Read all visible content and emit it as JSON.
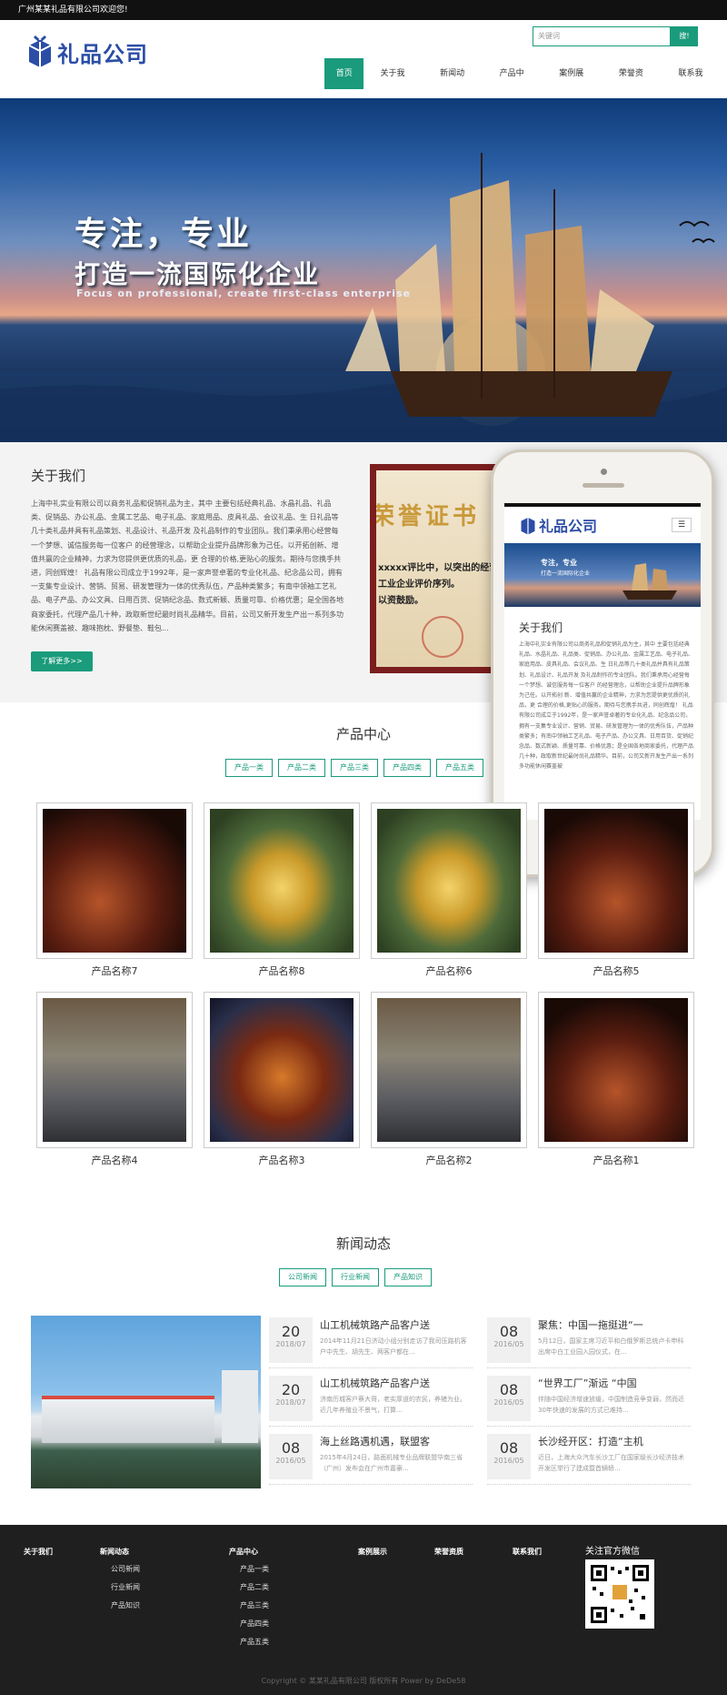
{
  "topbar": {
    "welcome": "广州某某礼品有限公司欢迎您!"
  },
  "header": {
    "logo_text": "礼品公司",
    "search_placeholder": "关键词",
    "search_button": "搜!",
    "nav": [
      "首页",
      "关于我们",
      "新闻动态",
      "产品中心",
      "案例展示",
      "荣誉资质",
      "联系我们"
    ]
  },
  "banner": {
    "headline1": "专注，专业",
    "headline2": "打造一流国际化企业",
    "subtitle": "Focus on professional, create first-class enterprise"
  },
  "about": {
    "title": "关于我们",
    "text": "上海中礼实业有限公司以商务礼品和促销礼品为主，其中 主要包括经典礼品、水晶礼品、礼品类、促销品、办公礼品、金属工艺品、电子礼品、家庭用品、皮具礼品、会议礼品、生 日礼品等几十类礼品并具有礼品策划、礼品设计、礼品开发 及礼品制作的专业团队。我们秉承用心经营每一个梦想、诚信服务每一位客户 的经营理念，以帮助企业提升品牌形象为己任。以开拓创新、增值共赢的企业精神，力求为您提供更优质的礼品，更 合理的价格,更贴心的服务。期待与您携手共进，同创辉煌！ 礼品有限公司成立于1992年，是一家声誉卓著的专业化礼品、纪念品公司，拥有一支集专业设计、营销、贸易、研发管理为一体的优秀队伍，产品种类繁多；有南中领袖工艺礼品、电子产品、办公文具、日用百货、促销纪念品、数式新颖、质量可靠、价格优惠；是全国各地商家委托，代理产品几十种，政取新世纪最时尚礼品精华。目前，公司又新开发生产出一系列多功能休闲赛盖被、趣味抱枕、野餐垫、鞋包...",
    "more_button": "了解更多>>",
    "certificate": {
      "title": "荣誉证书",
      "line1": "xxxxx评比中，以突出的经营",
      "line2": "工业企业评价序列。",
      "line3": "以资鼓励。"
    }
  },
  "phone": {
    "logo_text": "礼品公司",
    "banner_line1": "专注，专业",
    "banner_line2": "打造一流国际化企业",
    "about_title": "关于我们",
    "about_text": "上海中礼实业有限公司以商务礼品和促销礼品为主，其中 主要包括经典礼品、水晶礼品、礼品类、促销品、办公礼品、金属工艺品、电子礼品、家庭用品、皮具礼品、会议礼品、生 日礼品等几十类礼品并具有礼品策划、礼品设计、礼品开发 及礼品制作的专业团队。我们秉承用心经营每一个梦想、诚信服务每一位客户 的经营理念，以帮助企业提升品牌形象为己任。以开拓创 新、增值共赢的企业精神，力求为您提供更优质的礼品，更 合理的价格,更贴心的服务。期待与您携手共进，同创辉煌！ 礼品有限公司成立于1992年，是一家声誉卓著的专业化礼品、纪念品公司，拥有一支集专业设计、营销、贸易、研发管理为一体的优秀队伍，产品种类繁多；有南中领袖工艺礼品、电子产品、办公文具、日用百货、促销纪念品、数式新颖、质量可靠、价格优惠；是全国各地商家委托，代理产品几十种，政取新世纪最时尚礼品精华。目前，公司又新开发生产出一系列多功能休闲赛盖被"
  },
  "products": {
    "title": "产品中心",
    "categories": [
      "产品一类",
      "产品二类",
      "产品三类",
      "产品四类",
      "产品五类"
    ],
    "items": [
      {
        "name": "产品名称7",
        "theme": "dragon"
      },
      {
        "name": "产品名称8",
        "theme": "gold"
      },
      {
        "name": "产品名称6",
        "theme": "gold"
      },
      {
        "name": "产品名称5",
        "theme": "dragon"
      },
      {
        "name": "产品名称4",
        "theme": "tea"
      },
      {
        "name": "产品名称3",
        "theme": "storm"
      },
      {
        "name": "产品名称2",
        "theme": "tea"
      },
      {
        "name": "产品名称1",
        "theme": "dragon"
      }
    ]
  },
  "news": {
    "title": "新闻动态",
    "categories": [
      "公司新闻",
      "行业新闻",
      "产品知识"
    ],
    "left": [
      {
        "day": "20",
        "ym": "2018/07",
        "title": "山工机械筑路产品客户送",
        "summary": "2014年11月21日济动小组分别走访了我司压路机客户中先生、胡先生、两客户都在..."
      },
      {
        "day": "20",
        "ym": "2018/07",
        "title": "山工机械筑路产品客户送",
        "summary": "济南历城客户蔡大哥，老实厚道的农民，养猪为业。近几年养殖业不景气，打算..."
      },
      {
        "day": "08",
        "ym": "2016/05",
        "title": "海上丝路遇机遇，联盟客",
        "summary": "2015年4月24日，路面机械专业品牌联盟华南三省（广州）发布会在广州市嘉豪..."
      }
    ],
    "right": [
      {
        "day": "08",
        "ym": "2016/05",
        "title": "聚焦：中国一拖挺进“一",
        "summary": "5月12日，国家主席习近平和白俄罗斯总统卢卡申科出席中白工业园入园仪式，在..."
      },
      {
        "day": "08",
        "ym": "2016/05",
        "title": "“世界工厂”渐远 “中国",
        "summary": "伴随中国经济增速放缓，中国制造竞争变弱，然而近30年快速的发展的方式已难持..."
      },
      {
        "day": "08",
        "ym": "2016/05",
        "title": "长沙经开区：打造“主机",
        "summary": "近日，上海大众汽车长沙工厂在国家级长沙经济技术开发区举行了建成暨首辆轿..."
      }
    ]
  },
  "footer": {
    "about": "关于我们",
    "news": "新闻动态",
    "news_items": [
      "公司新闻",
      "行业新闻",
      "产品知识"
    ],
    "products": "产品中心",
    "product_items": [
      "产品一类",
      "产品二类",
      "产品三类",
      "产品四类",
      "产品五类"
    ],
    "cases": "案例展示",
    "honors": "荣誉资质",
    "contact": "联系我们",
    "wechat": "关注官方微信",
    "copyright": "Copyright © 某某礼品有限公司 版权所有 Power by DeDe58"
  },
  "colors": {
    "accent": "#1a9b7b",
    "brand": "#2b4da6",
    "footer_bg": "#1f1f1f"
  }
}
